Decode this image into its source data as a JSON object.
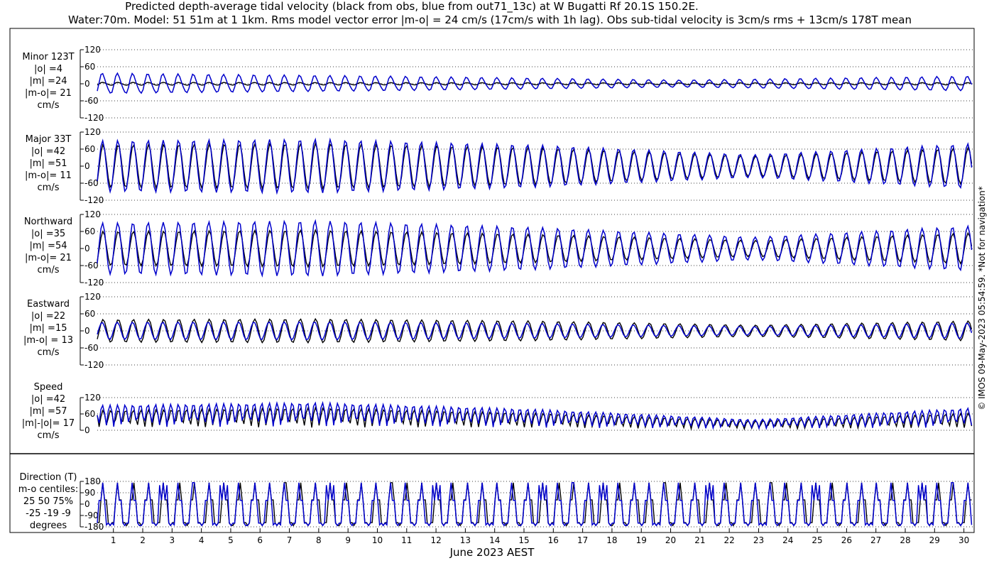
{
  "title": {
    "line1": "Predicted depth-average tidal velocity (black from obs, blue from out71_13c) at W Bugatti Rf 20.1S 150.2E.",
    "line2": "Water:70m. Model: 51 51m at 1 1km. Rms model vector error |m-o| = 24 cm/s (17cm/s with 1h lag). Obs sub-tidal velocity is 3cm/s rms + 13cm/s 178T mean"
  },
  "xlabel": "June 2023 AEST",
  "copyright": "© IMOS 09-May-2023 05:54:59. *Not for navigation*",
  "colors": {
    "obs": "#000000",
    "model": "#0000cc"
  },
  "chart_data": {
    "type": "line",
    "x_unit": "day of June 2023",
    "xlim": [
      0.45,
      30.3
    ],
    "x_ticks": [
      1,
      2,
      3,
      4,
      5,
      6,
      7,
      8,
      9,
      10,
      11,
      12,
      13,
      14,
      15,
      16,
      17,
      18,
      19,
      20,
      21,
      22,
      23,
      24,
      25,
      26,
      27,
      28,
      29,
      30
    ],
    "series_names": [
      "obs (black)",
      "model (blue)"
    ],
    "sample_step_days": 0.0625,
    "panels": [
      {
        "key": "minor",
        "labels": [
          "Minor 123T",
          "|o| =4",
          "|m| =24",
          "|m-o|= 21",
          "cm/s"
        ],
        "ylim": [
          -120,
          120
        ],
        "yticks": [
          -120,
          -60,
          0,
          60,
          120
        ],
        "series": [
          {
            "name": "obs",
            "envelope_amplitude_cm_s": [
              5,
              4,
              3,
              4
            ]
          },
          {
            "name": "model",
            "envelope_amplitude_cm_s": [
              35,
              25,
              12,
              25
            ]
          }
        ]
      },
      {
        "key": "major",
        "labels": [
          "Major 33T",
          "|o| =42",
          "|m| =51",
          "|m-o|= 11",
          "cm/s"
        ],
        "ylim": [
          -120,
          120
        ],
        "yticks": [
          -120,
          -60,
          0,
          60,
          120
        ],
        "series": [
          {
            "name": "obs",
            "envelope_amplitude_cm_s": [
              75,
              80,
              65,
              35,
              65
            ]
          },
          {
            "name": "model",
            "envelope_amplitude_cm_s": [
              90,
              95,
              75,
              40,
              80
            ]
          }
        ]
      },
      {
        "key": "north",
        "labels": [
          "Northward",
          "|o| =35",
          "|m| =54",
          "|m-o|= 21",
          "cm/s"
        ],
        "ylim": [
          -120,
          120
        ],
        "yticks": [
          -120,
          -60,
          0,
          60,
          120
        ],
        "series": [
          {
            "name": "obs",
            "envelope_amplitude_cm_s": [
              60,
              65,
              50,
              28,
              55
            ]
          },
          {
            "name": "model",
            "envelope_amplitude_cm_s": [
              90,
              98,
              75,
              40,
              80
            ]
          }
        ]
      },
      {
        "key": "east",
        "labels": [
          "Eastward",
          "|o| =22",
          "|m| =15",
          "|m-o| = 13",
          "cm/s"
        ],
        "ylim": [
          -120,
          120
        ],
        "yticks": [
          -120,
          -60,
          0,
          60,
          120
        ],
        "series": [
          {
            "name": "obs",
            "envelope_amplitude_cm_s": [
              40,
              42,
              35,
              20,
              35
            ]
          },
          {
            "name": "model",
            "envelope_amplitude_cm_s": [
              30,
              32,
              26,
              15,
              28
            ]
          }
        ]
      },
      {
        "key": "speed",
        "labels": [
          "Speed",
          "|o| =42",
          "|m| =57",
          "|m|-|o|= 17",
          "cm/s"
        ],
        "ylim": [
          0,
          120
        ],
        "yticks": [
          0,
          60,
          120
        ],
        "series": [
          {
            "name": "obs",
            "peak_cm_s": [
              75,
              85,
              65,
              35,
              65
            ]
          },
          {
            "name": "model",
            "peak_cm_s": [
              95,
              105,
              80,
              40,
              85
            ]
          }
        ]
      },
      {
        "key": "direction",
        "labels": [
          "Direction (T)",
          "m-o centiles:",
          "25  50  75%",
          "-25 -19  -9",
          "degrees"
        ],
        "ylim": [
          -180,
          180
        ],
        "yticks": [
          -180,
          -90,
          0,
          90,
          180
        ],
        "series": [
          {
            "name": "obs",
            "flood_deg": 33,
            "ebb_deg": -147
          },
          {
            "name": "model",
            "flood_deg": 30,
            "ebb_deg": -150
          }
        ]
      }
    ]
  }
}
